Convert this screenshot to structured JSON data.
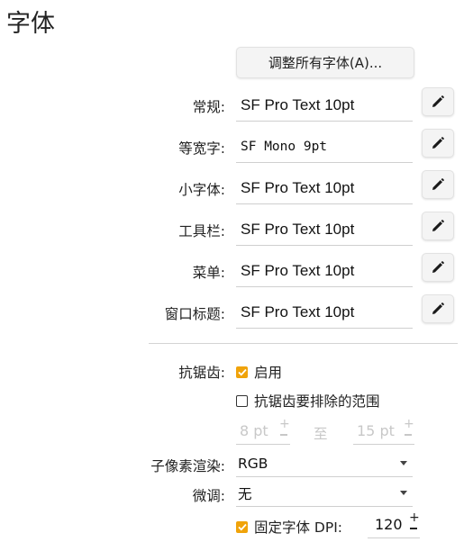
{
  "page": {
    "title": "字体"
  },
  "adjust_all_button": "调整所有字体(A)...",
  "fonts": [
    {
      "label": "常规:",
      "value": "SF Pro Text 10pt"
    },
    {
      "label": "等宽字:",
      "value": "SF Mono 9pt"
    },
    {
      "label": "小字体:",
      "value": "SF Pro Text 10pt"
    },
    {
      "label": "工具栏:",
      "value": "SF Pro Text 10pt"
    },
    {
      "label": "菜单:",
      "value": "SF Pro Text 10pt"
    },
    {
      "label": "窗口标题:",
      "value": "SF Pro Text 10pt"
    }
  ],
  "antialias": {
    "label": "抗锯齿:",
    "enable_label": "启用",
    "enable_checked": true,
    "exclude_label": "抗锯齿要排除的范围",
    "exclude_checked": false,
    "range_from": "8 pt",
    "range_to_label": "至",
    "range_to": "15 pt"
  },
  "subpixel": {
    "label": "子像素渲染:",
    "value": "RGB"
  },
  "hinting": {
    "label": "微调:",
    "value": "无"
  },
  "dpi": {
    "label": "固定字体 DPI:",
    "checked": true,
    "value": "120"
  },
  "colors": {
    "accent": "#f0a30a"
  }
}
